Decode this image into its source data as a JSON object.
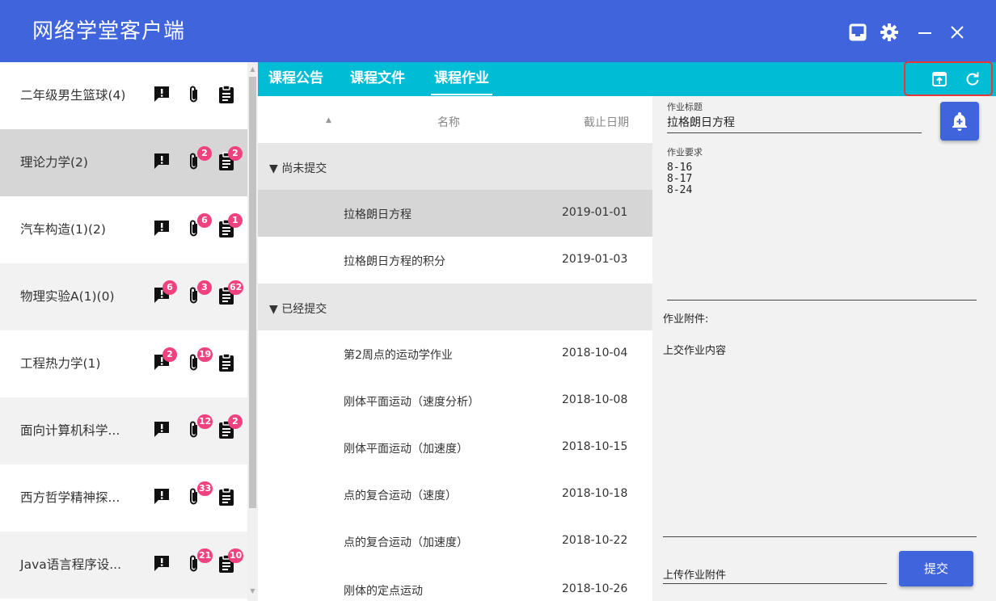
{
  "window": {
    "title": "网络学堂客户端"
  },
  "courses": [
    {
      "name": "二年级男生篮球(4)",
      "notice_badge": "",
      "file_badge": "",
      "hw_badge": ""
    },
    {
      "name": "理论力学(2)",
      "notice_badge": "",
      "file_badge": "2",
      "hw_badge": "2"
    },
    {
      "name": "汽车构造(1)(2)",
      "notice_badge": "",
      "file_badge": "6",
      "hw_badge": "1"
    },
    {
      "name": "物理实验A(1)(0)",
      "notice_badge": "6",
      "file_badge": "3",
      "hw_badge": "62"
    },
    {
      "name": "工程热力学(1)",
      "notice_badge": "2",
      "file_badge": "19",
      "hw_badge": ""
    },
    {
      "name": "面向计算机科学...",
      "notice_badge": "",
      "file_badge": "12",
      "hw_badge": "2"
    },
    {
      "name": "西方哲学精神探...",
      "notice_badge": "",
      "file_badge": "33",
      "hw_badge": ""
    },
    {
      "name": "Java语言程序设...",
      "notice_badge": "",
      "file_badge": "21",
      "hw_badge": "10"
    }
  ],
  "tabs": [
    {
      "label": "课程公告"
    },
    {
      "label": "课程文件"
    },
    {
      "label": "课程作业"
    }
  ],
  "table": {
    "col_name": "名称",
    "col_deadline": "截止日期",
    "groups": [
      {
        "label": "尚未提交",
        "rows": [
          {
            "name": "拉格朗日方程",
            "deadline": "2019-01-01"
          },
          {
            "name": "拉格朗日方程的积分",
            "deadline": "2019-01-03"
          }
        ]
      },
      {
        "label": "已经提交",
        "rows": [
          {
            "name": "第2周点的运动学作业",
            "deadline": "2018-10-04"
          },
          {
            "name": "刚体平面运动（速度分析）",
            "deadline": "2018-10-08"
          },
          {
            "name": "刚体平面运动（加速度）",
            "deadline": "2018-10-15"
          },
          {
            "name": "点的复合运动（速度）",
            "deadline": "2018-10-18"
          },
          {
            "name": "点的复合运动（加速度）",
            "deadline": "2018-10-22"
          },
          {
            "name": "刚体的定点运动",
            "deadline": "2018-10-26"
          }
        ]
      }
    ]
  },
  "detail": {
    "title_label": "作业标题",
    "title_value": "拉格朗日方程",
    "requirement_label": "作业要求",
    "requirement_value": "8-16\n8-17\n8-24",
    "attachment_label": "作业附件:",
    "submission_label": "上交作业内容",
    "upload_label": "上传作业附件",
    "submit_label": "提交"
  },
  "colors": {
    "titlebar": "#3f64dc",
    "tabbar": "#00bcd4",
    "badge": "#f0427e",
    "highlight_box": "#e53935"
  },
  "icons": [
    "inbox-icon",
    "gear-icon",
    "minimize-icon",
    "close-icon",
    "upload-icon",
    "refresh-icon",
    "notice-icon",
    "attachment-icon",
    "homework-icon",
    "add-alert-icon"
  ]
}
